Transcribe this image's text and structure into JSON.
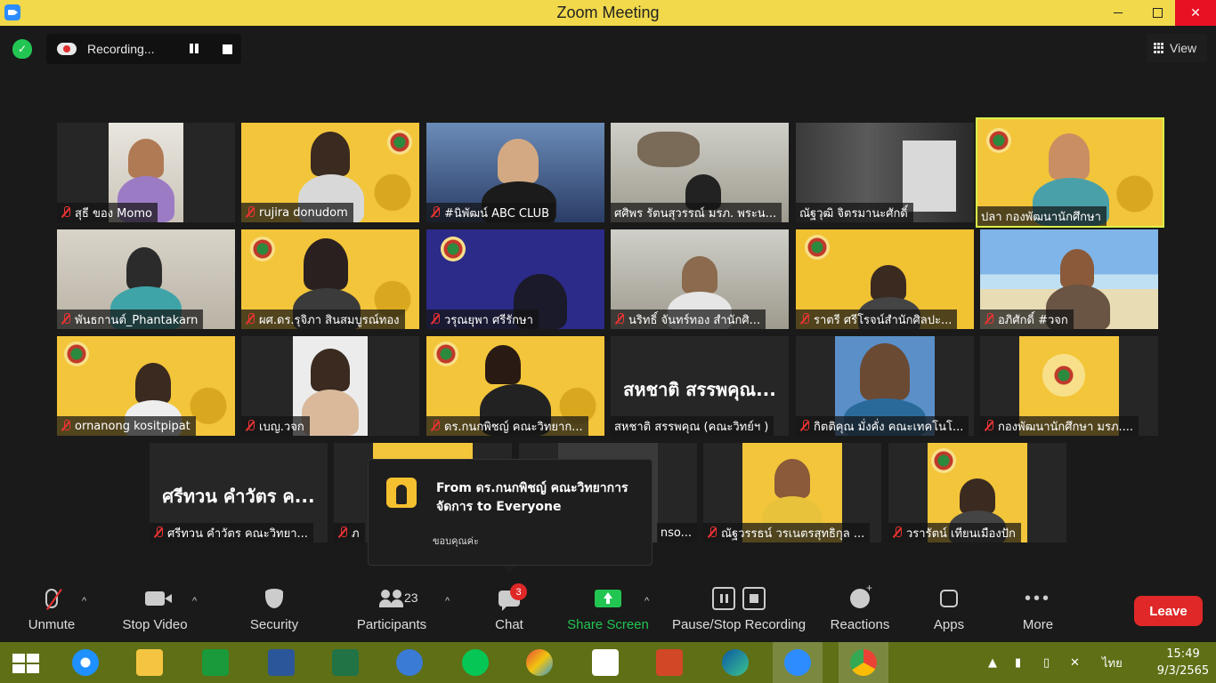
{
  "window": {
    "title": "Zoom Meeting"
  },
  "topbar": {
    "recording_label": "Recording...",
    "view_label": "View"
  },
  "participants": [
    {
      "name": "สุธี ของ Momo"
    },
    {
      "name": "rujira donudom"
    },
    {
      "name": "#นิพัฒน์ ABC CLUB"
    },
    {
      "name": "ศศิพร รัตนสุวรรณ์ มรภ. พระน..."
    },
    {
      "name": "ณัฐวุฒิ จิตรมานะศักดิ์"
    },
    {
      "name": "ปลา  กองพัฒนานักศึกษา"
    },
    {
      "name": "พันธกานต์_Phantakarn"
    },
    {
      "name": "ผศ.ดร.รุจิภา สินสมบูรณ์ทอง"
    },
    {
      "name": "วรุณยุพา ศรีรักษา"
    },
    {
      "name": "นริทธิ์ จันทร์ทอง สำนักศิ..."
    },
    {
      "name": "ราตรี   ศรีโรจน์สำนักศิลปะ..."
    },
    {
      "name": "อภิศักดิ์ #วจก"
    },
    {
      "name": "ornanong kositpipat"
    },
    {
      "name": "เบญ.วจก"
    },
    {
      "name": "ดร.กนกพิชญ์ คณะวิทยาก..."
    },
    {
      "name": "สหชาติ สรรพคุณ (คณะวิทย์ฯ )",
      "big": "สหชาติ สรรพคุณ..."
    },
    {
      "name": "กิตติคุณ มั่งคั่ง คณะเทคโนโ..."
    },
    {
      "name": "กองพัฒนานักศึกษา มรภ...."
    },
    {
      "name": "ศรีทวน  คำวัตร คณะวิทยา...",
      "big": "ศรีทวน  คำวัตร ค..."
    },
    {
      "name": "ภ"
    },
    {
      "name": "nso..."
    },
    {
      "name": "ณัฐวรรธน์ วรเนตรสุทธิกุล ..."
    },
    {
      "name": "วรารัตน์ เทียนเมืองปัก"
    }
  ],
  "chat_popup": {
    "from": "From ดร.กนกพิชญ์ คณะวิทยาการจัดการ to Everyone",
    "message": "ขอบคุณค่ะ"
  },
  "toolbar": {
    "unmute": "Unmute",
    "stop_video": "Stop Video",
    "security": "Security",
    "participants": "Participants",
    "participant_count": "23",
    "chat": "Chat",
    "chat_badge": "3",
    "share_screen": "Share Screen",
    "pause_stop_recording": "Pause/Stop Recording",
    "reactions": "Reactions",
    "apps": "Apps",
    "more": "More",
    "leave": "Leave"
  },
  "taskbar": {
    "language": "ไทย",
    "time": "15:49",
    "date": "9/3/2565"
  },
  "colors": {
    "share": "#23c552",
    "leave": "#e02828",
    "titlebar": "#f1d94b",
    "speaking": "#d9f24a"
  }
}
